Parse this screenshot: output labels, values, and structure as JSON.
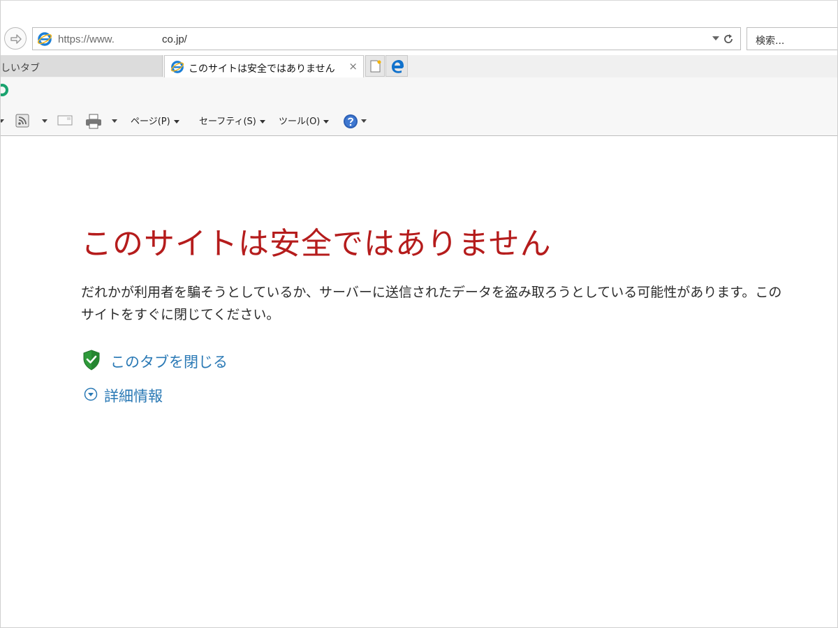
{
  "address_bar": {
    "url_prefix": "https://www.",
    "url_suffix": "co.jp/"
  },
  "search": {
    "placeholder": "検索..."
  },
  "tabs": [
    {
      "label": "しいタブ",
      "active": false
    },
    {
      "label": "このサイトは安全ではありません",
      "active": true,
      "close_glyph": "×"
    }
  ],
  "command_bar": {
    "page_menu": "ページ(P)",
    "safety_menu": "セーフティ(S)",
    "tools_menu": "ツール(O)"
  },
  "error_page": {
    "title": "このサイトは安全ではありません",
    "body": "だれかが利用者を騙そうとしているか、サーバーに送信されたデータを盗み取ろうとしている可能性があります。このサイトをすぐに閉じてください。",
    "close_tab_link": "このタブを閉じる",
    "details_link": "詳細情報"
  },
  "icons": {
    "forward": "forward-arrow-icon",
    "site": "ie-logo-icon",
    "refresh": "refresh-icon",
    "new_tab": "new-tab-icon",
    "edge": "edge-logo-icon",
    "rss": "rss-feed-icon",
    "mail": "mail-icon",
    "print": "printer-icon",
    "help": "help-icon",
    "shield": "shield-check-icon",
    "expand": "chevron-down-circle-icon"
  },
  "colors": {
    "title_red": "#b51c1c",
    "link_blue": "#2a79b5",
    "shield_green": "#2e9a3a"
  }
}
